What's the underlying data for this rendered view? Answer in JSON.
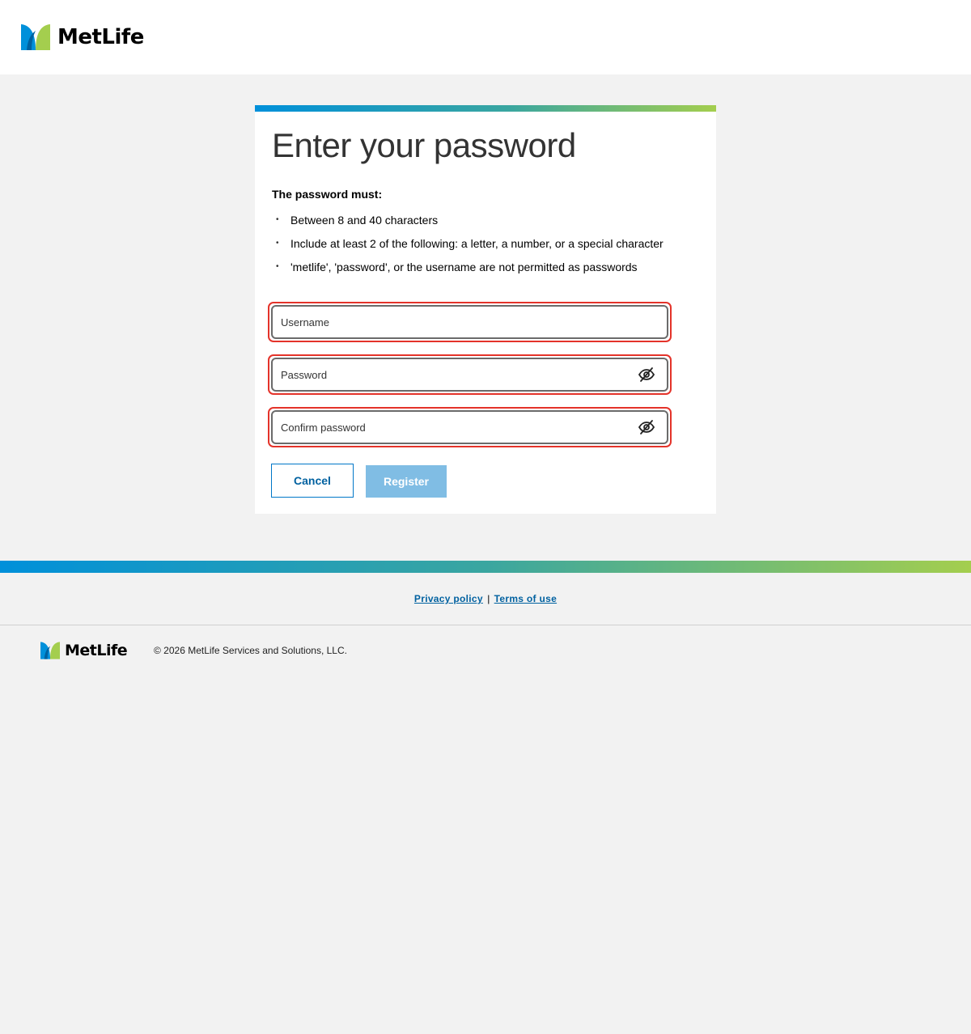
{
  "brand": {
    "name": "MetLife",
    "colors": {
      "blue": "#0090da",
      "green": "#a4ce4e",
      "link": "#0061a0",
      "error": "#e4332a"
    }
  },
  "card": {
    "title": "Enter your password",
    "rules_heading": "The password must:",
    "rules": [
      "Between 8 and 40 characters",
      "Include at least 2 of the following: a letter, a number, or a special character",
      "'metlife', 'password', or the username are not permitted as passwords"
    ]
  },
  "form": {
    "username_placeholder": "Username",
    "password_placeholder": "Password",
    "confirm_placeholder": "Confirm password",
    "show_password_icon": "eye-slash-icon"
  },
  "buttons": {
    "cancel": "Cancel",
    "register": "Register",
    "register_state": "disabled"
  },
  "footer": {
    "privacy": "Privacy policy",
    "separator": "|",
    "terms": "Terms of use",
    "copyright": "© 2026 MetLife Services and Solutions, LLC."
  }
}
